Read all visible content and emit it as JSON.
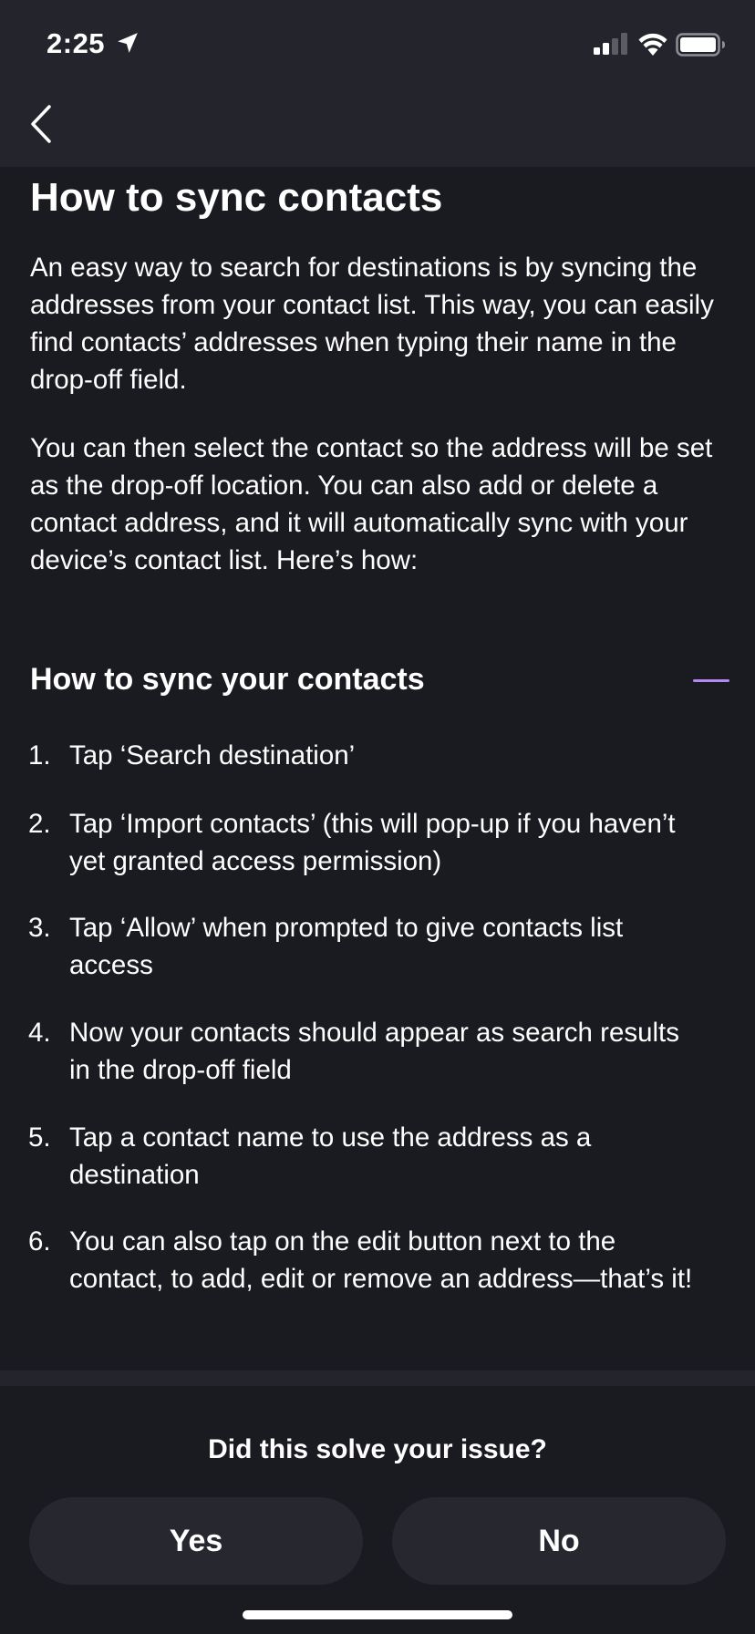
{
  "status_bar": {
    "time": "2:25"
  },
  "nav": {
    "back_icon": "chevron-left-icon"
  },
  "article": {
    "title": "How to sync contacts",
    "paragraphs": [
      "An easy way to search for destinations is by syncing the addresses from your contact list. This way, you can easily find contacts’ addresses when typing their name in the drop-off field.",
      "You can then select the contact so the address will be set as the drop-off location. You can also add or delete a contact address, and it will automatically sync with your device’s contact list. Here’s how:"
    ],
    "section": {
      "title": "How to sync your contacts",
      "expanded": true,
      "accent_color": "#b289f0",
      "steps": [
        {
          "num": "1.",
          "text": "Tap ‘Search destination’"
        },
        {
          "num": "2.",
          "text": "Tap ‘Import contacts’ (this will pop-up if you haven’t yet granted access permission)"
        },
        {
          "num": "3.",
          "text": "Tap ‘Allow’ when prompted to give contacts list access"
        },
        {
          "num": "4.",
          "text": "Now your contacts should appear as search results in the drop-off field"
        },
        {
          "num": "5.",
          "text": "Tap a contact name to use the address as a destination"
        },
        {
          "num": "6.",
          "text": "You can also tap on the edit button next to the contact, to add, edit or remove an address—that’s it!"
        }
      ]
    }
  },
  "feedback": {
    "question": "Did this solve your issue?",
    "yes_label": "Yes",
    "no_label": "No"
  },
  "colors": {
    "background": "#1a1a21",
    "topbar": "#24242c",
    "button": "#272730",
    "accent": "#b289f0"
  }
}
